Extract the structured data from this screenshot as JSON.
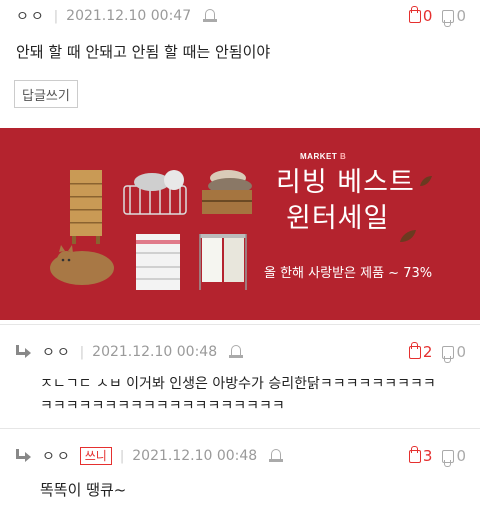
{
  "comments": [
    {
      "author": "ㅇㅇ",
      "date": "2021.12.10 00:47",
      "up": "0",
      "down": "0",
      "content": "안돼 할 때 안돼고 안됨 할 때는 안됨이야"
    },
    {
      "author": "ㅇㅇ",
      "date": "2021.12.10 00:48",
      "up": "2",
      "down": "0",
      "content_line1": "ㅈㄴㄱㄷ ㅅㅂ 이거봐 인생은 아방수가 승리한닭ㅋㅋㅋㅋㅋㅋㅋㅋㅋ",
      "content_line2": "ㅋㅋㅋㅋㅋㅋㅋㅋㅋㅋㅋㅋㅋㅋㅋㅋㅋㅋㅋ"
    },
    {
      "author": "ㅇㅇ",
      "badge": "쓰니",
      "date": "2021.12.10 00:48",
      "up": "3",
      "down": "0",
      "content": "똑똑이 땡큐~"
    }
  ],
  "reply_button": "답글쓰기",
  "ad": {
    "brand_prefix": "MARKET",
    "brand_suffix": "B",
    "headline_1": "리빙 베스트",
    "headline_2": "윈터세일",
    "subtext": "올 한해 사랑받은 제품 ~ 73%",
    "background": "#b4232e"
  },
  "colors": {
    "up_red": "#e5302f",
    "muted": "#999999"
  },
  "icons": {
    "thumb_up": "thumb-up-icon",
    "thumb_down": "thumb-down-icon",
    "report": "report-icon",
    "reply": "reply-arrow-icon"
  }
}
